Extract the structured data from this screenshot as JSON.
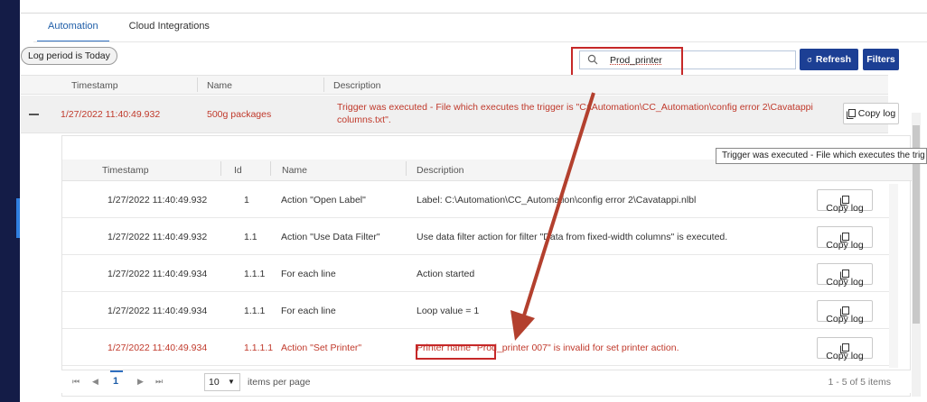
{
  "tabs": [
    {
      "label": "Automation"
    },
    {
      "label": "Cloud Integrations"
    }
  ],
  "toolbar": {
    "period_label": "Log period is Today",
    "search_value": "Prod_printer",
    "refresh_label": "Refresh",
    "filters_label": "Filters"
  },
  "outer_table": {
    "columns": [
      "Timestamp",
      "Name",
      "Description"
    ],
    "row": {
      "timestamp": "1/27/2022 11:40:49.932",
      "name": "500g packages",
      "description": "Trigger was executed - File which executes the trigger is \"C:\\Automation\\CC_Automation\\config error 2\\Cavatappi columns.txt\".",
      "copy_label": "Copy log"
    }
  },
  "tooltip": "Trigger was executed - File which executes the trig",
  "inner_table": {
    "columns": [
      "Timestamp",
      "Id",
      "Name",
      "Description"
    ],
    "rows": [
      {
        "timestamp": "1/27/2022 11:40:49.932",
        "id": "1",
        "name": "Action \"Open Label\"",
        "description": "Label: C:\\Automation\\CC_Automation\\config error 2\\Cavatappi.nlbl",
        "copy": "Copy log"
      },
      {
        "timestamp": "1/27/2022 11:40:49.932",
        "id": "1.1",
        "name": "Action \"Use Data Filter\"",
        "description": "Use data filter action for filter \"Data from fixed-width columns\" is executed.",
        "copy": "Copy log"
      },
      {
        "timestamp": "1/27/2022 11:40:49.934",
        "id": "1.1.1",
        "name": "For each line",
        "description": "Action started",
        "copy": "Copy log"
      },
      {
        "timestamp": "1/27/2022 11:40:49.934",
        "id": "1.1.1",
        "name": "For each line",
        "description": "Loop value = 1",
        "copy": "Copy log"
      },
      {
        "timestamp": "1/27/2022 11:40:49.934",
        "id": "1.1.1.1",
        "name": "Action \"Set Printer\"",
        "description": "Printer name \"Prod_printer 007\" is invalid for set printer action.",
        "copy": "Copy log"
      }
    ]
  },
  "pager": {
    "current_page": "1",
    "page_size": "10",
    "items_per_page_label": "items per page",
    "range_text": "1 - 5 of 5 items"
  },
  "colors": {
    "accent": "#1c3f94",
    "error": "#c0392b",
    "highlight": "#c62828"
  }
}
